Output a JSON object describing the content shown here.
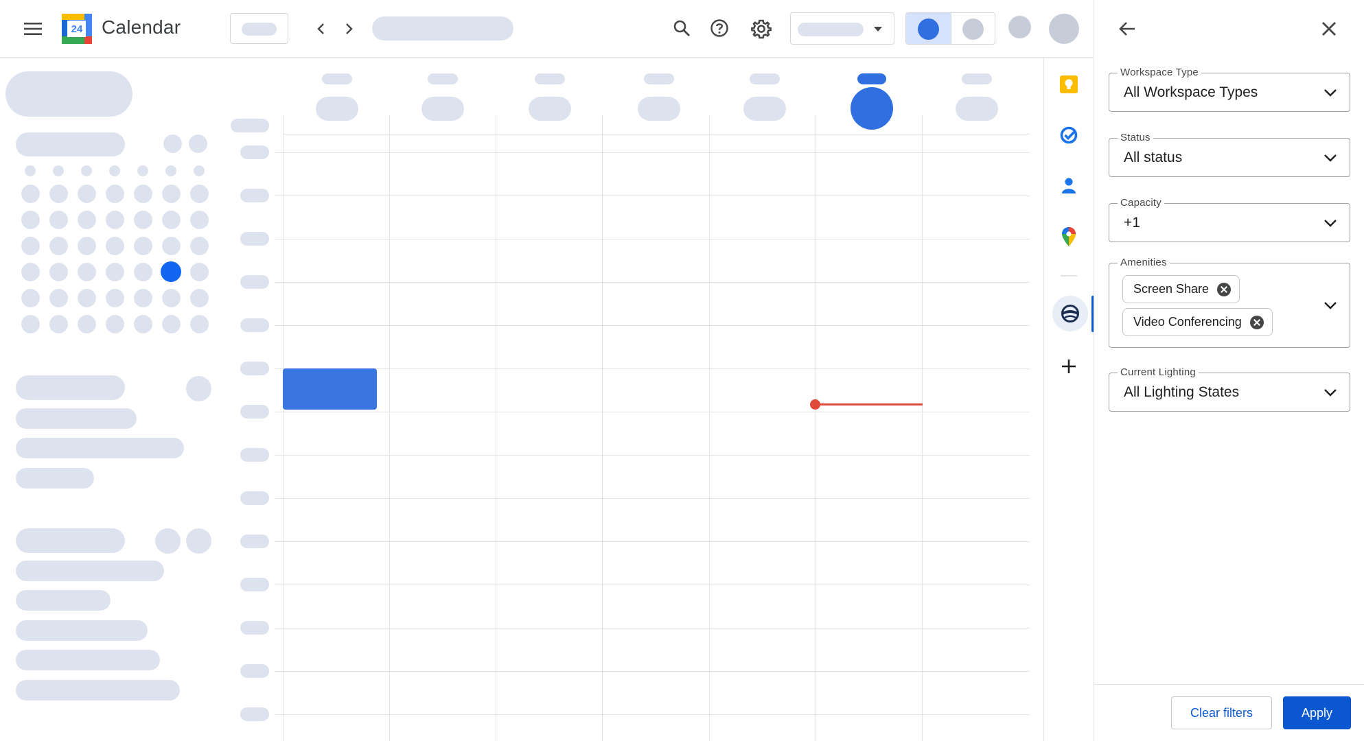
{
  "header": {
    "app_title": "Calendar",
    "logo_day": "24",
    "icons": [
      "menu-icon",
      "chevron-left-icon",
      "chevron-right-icon",
      "search-icon",
      "help-icon",
      "settings-icon"
    ]
  },
  "rail": {
    "icons": [
      "keep-icon",
      "tasks-icon",
      "contacts-icon",
      "maps-icon",
      "workspace-icon",
      "add-icon"
    ]
  },
  "panel": {
    "fields": {
      "workspace_type": {
        "label": "Workspace Type",
        "value": "All Workspace Types"
      },
      "status": {
        "label": "Status",
        "value": "All status"
      },
      "capacity": {
        "label": "Capacity",
        "value": "+1"
      },
      "amenities": {
        "label": "Amenities",
        "chips": [
          "Screen Share",
          "Video Conferencing"
        ]
      },
      "current_lighting": {
        "label": "Current Lighting",
        "value": "All Lighting States"
      }
    },
    "clear_label": "Clear filters",
    "apply_label": "Apply"
  },
  "colors": {
    "accent": "#0b57d0",
    "event": "#3a76e0",
    "now_line": "#e04a3a",
    "skeleton": "#dde3ee",
    "selected_day": "#1266f1"
  }
}
